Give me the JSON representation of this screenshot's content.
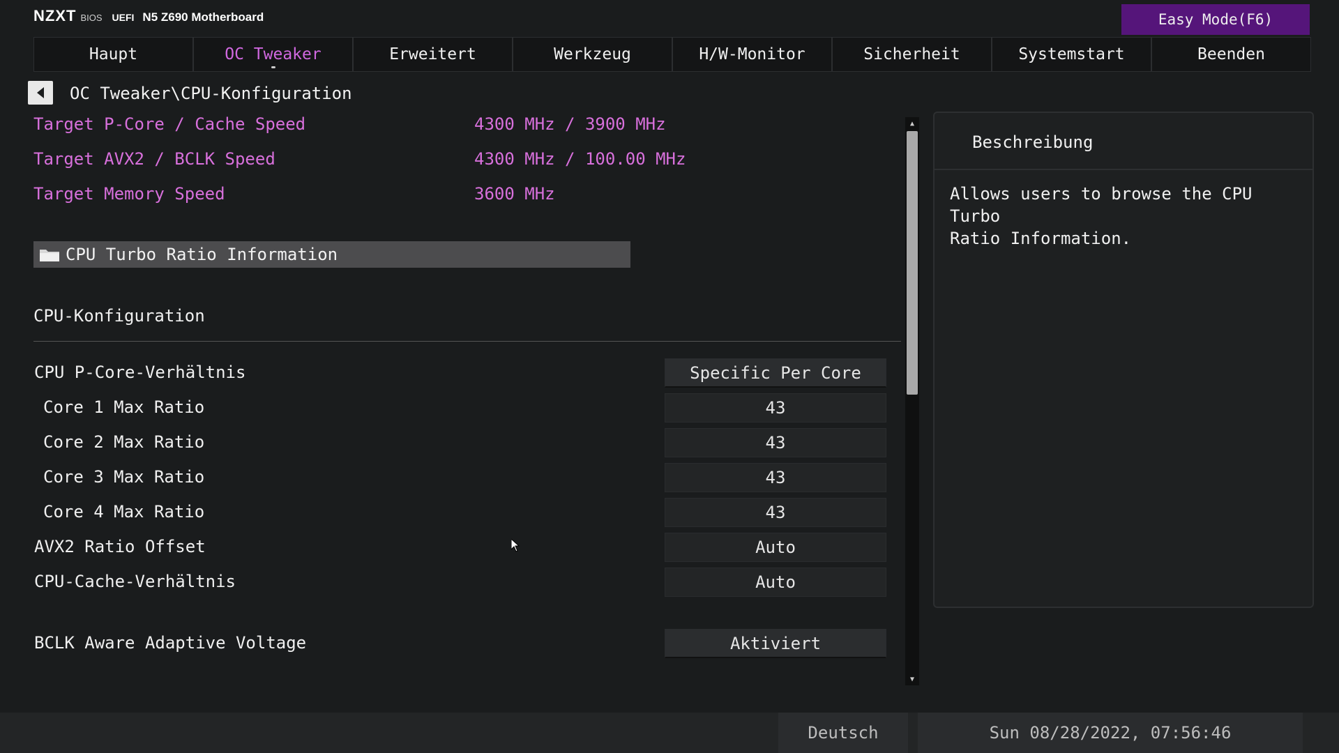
{
  "header": {
    "brand": "NZXT",
    "bios": "BIOS",
    "uefi": "UEFI",
    "model": "N5 Z690 Motherboard",
    "easy_mode": "Easy Mode(F6)"
  },
  "tabs": [
    {
      "label": "Haupt"
    },
    {
      "label": "OC Tweaker",
      "active": true
    },
    {
      "label": "Erweitert"
    },
    {
      "label": "Werkzeug"
    },
    {
      "label": "H/W-Monitor"
    },
    {
      "label": "Sicherheit"
    },
    {
      "label": "Systemstart"
    },
    {
      "label": "Beenden"
    }
  ],
  "breadcrumb": "OC Tweaker\\CPU-Konfiguration",
  "info": [
    {
      "label": "Target P-Core / Cache Speed",
      "value": "4300 MHz / 3900 MHz"
    },
    {
      "label": "Target AVX2 / BCLK Speed",
      "value": "4300 MHz / 100.00 MHz"
    },
    {
      "label": "Target Memory Speed",
      "value": "3600 MHz"
    }
  ],
  "submenu": {
    "label": "CPU Turbo Ratio Information",
    "icon": "folder-icon"
  },
  "section_title": "CPU-Konfiguration",
  "settings": [
    {
      "label": "CPU P-Core-Verhältnis",
      "value": "Specific Per Core"
    },
    {
      "label": "Core 1 Max Ratio",
      "value": "43"
    },
    {
      "label": "Core 2 Max Ratio",
      "value": "43"
    },
    {
      "label": "Core 3 Max Ratio",
      "value": "43"
    },
    {
      "label": "Core 4 Max Ratio",
      "value": "43"
    },
    {
      "label": "AVX2 Ratio Offset",
      "value": "Auto"
    },
    {
      "label": "CPU-Cache-Verhältnis",
      "value": "Auto"
    },
    {
      "label": "BCLK Aware Adaptive Voltage",
      "value": "Aktiviert"
    }
  ],
  "description": {
    "title": "Beschreibung",
    "text": "Allows users to browse the CPU Turbo\nRatio Information."
  },
  "footer": {
    "language": "Deutsch",
    "datetime": "Sun 08/28/2022, 07:56:46"
  },
  "colors": {
    "accent_purple": "#55157a",
    "info_magenta": "#d870dc",
    "active_tab": "#d068e0"
  }
}
